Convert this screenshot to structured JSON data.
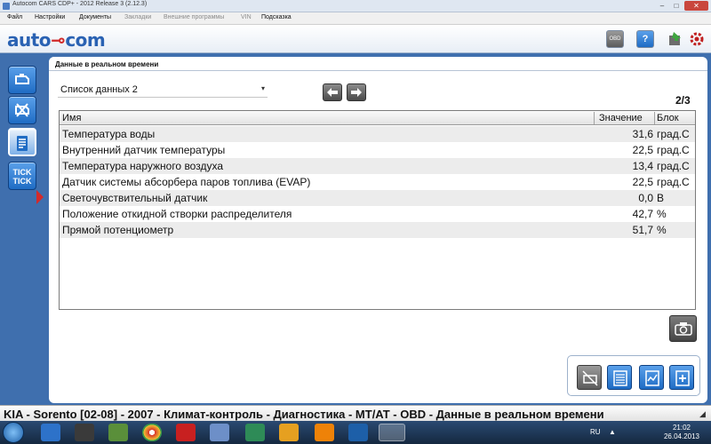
{
  "window": {
    "title": "Autocom CARS CDP+ - 2012 Release 3 (2.12.3)"
  },
  "menu": [
    {
      "label": "Файл",
      "disabled": false
    },
    {
      "label": "Настройки",
      "disabled": false
    },
    {
      "label": "Документы",
      "disabled": false
    },
    {
      "label": "Закладки",
      "disabled": true
    },
    {
      "label": "Внешние программы",
      "disabled": true
    },
    {
      "label": "VIN",
      "disabled": true
    },
    {
      "label": "Подсказка",
      "disabled": false
    }
  ],
  "logo": {
    "part1": "auto",
    "part2": "com"
  },
  "header_buttons": {
    "obd": "OBD",
    "help": "?"
  },
  "tab": {
    "label": "Данные в реальном времени"
  },
  "dataset": {
    "selected": "Список данных 2"
  },
  "pagination": {
    "label": "2/3"
  },
  "table": {
    "headers": {
      "name": "Имя",
      "value": "Значение",
      "unit": "Блок"
    },
    "rows": [
      {
        "name": "Температура воды",
        "value": "31,6",
        "unit": "град.С"
      },
      {
        "name": "Внутренний датчик температуры",
        "value": "22,5",
        "unit": "град.С"
      },
      {
        "name": "Температура наружного воздуха",
        "value": "13,4",
        "unit": "град.С"
      },
      {
        "name": "Датчик системы абсорбера паров топлива (EVAP)",
        "value": "22,5",
        "unit": "град.С"
      },
      {
        "name": "Светочувствительный датчик",
        "value": "0,0",
        "unit": "В"
      },
      {
        "name": "Положение откидной створки распределителя",
        "value": "42,7",
        "unit": "%"
      },
      {
        "name": "Прямой потенциометр",
        "value": "51,7",
        "unit": "%"
      }
    ]
  },
  "nav": {
    "tick_label_1": "TICK",
    "tick_label_2": "TICK"
  },
  "breadcrumb": "KIA - Sorento [02-08] - 2007 - Климат-контроль - Диагностика - MT/AT - OBD - Данные в реальном времени",
  "taskbar": {
    "lang": "RU",
    "time": "21:02",
    "date": "26.04.2013"
  }
}
